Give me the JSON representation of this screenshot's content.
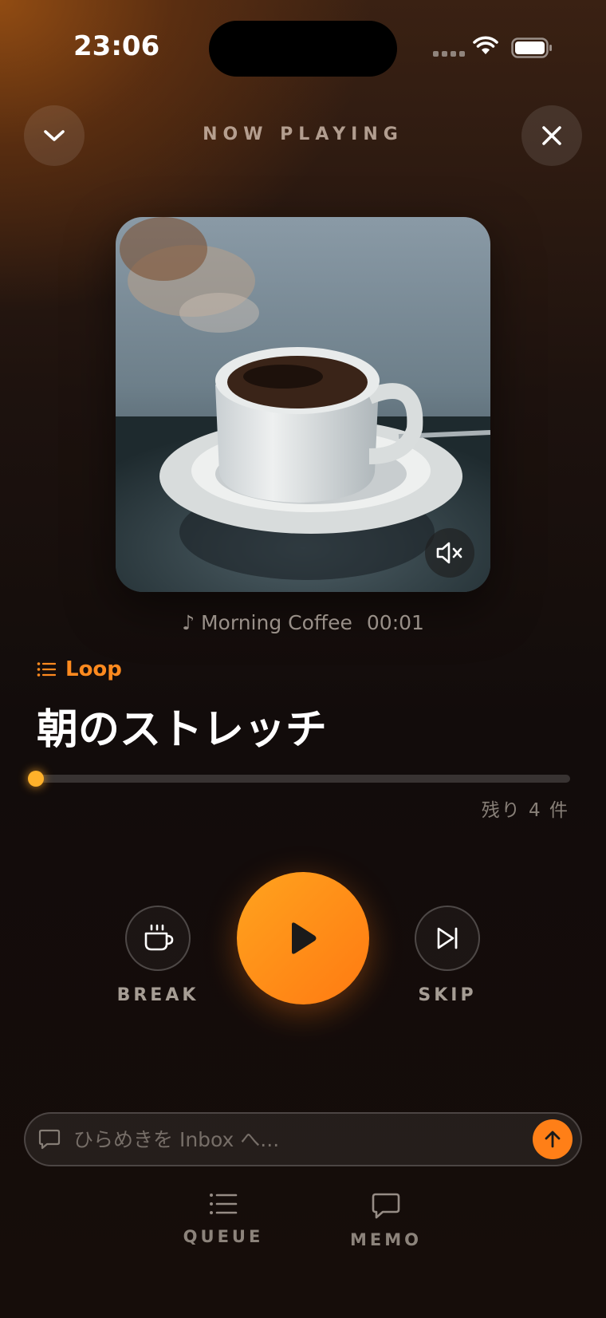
{
  "status_bar": {
    "time": "23:06"
  },
  "header": {
    "title": "NOW PLAYING",
    "collapse_icon": "chevron-down-icon",
    "close_icon": "close-icon"
  },
  "artwork": {
    "description_icon": "coffee-cup-photo",
    "mute_icon": "speaker-muted-icon"
  },
  "now_playing": {
    "note_glyph": "♪",
    "track_name": "Morning Coffee",
    "elapsed": "00:01"
  },
  "playlist": {
    "mode_label": "Loop",
    "mode_icon": "list-icon"
  },
  "task": {
    "title": "朝のストレッチ"
  },
  "progress": {
    "fraction": 0.0,
    "remaining": "残り 4 件"
  },
  "controls": {
    "break_label": "BREAK",
    "skip_label": "SKIP",
    "play_icon": "play-icon"
  },
  "memo": {
    "placeholder": "ひらめきを Inbox へ...",
    "send_icon": "arrow-up-icon"
  },
  "tabs": [
    {
      "label": "QUEUE",
      "icon": "list-icon"
    },
    {
      "label": "MEMO",
      "icon": "chat-bubble-icon"
    }
  ],
  "colors": {
    "accent": "#ff8a1f",
    "progress": "#ffb12a"
  }
}
